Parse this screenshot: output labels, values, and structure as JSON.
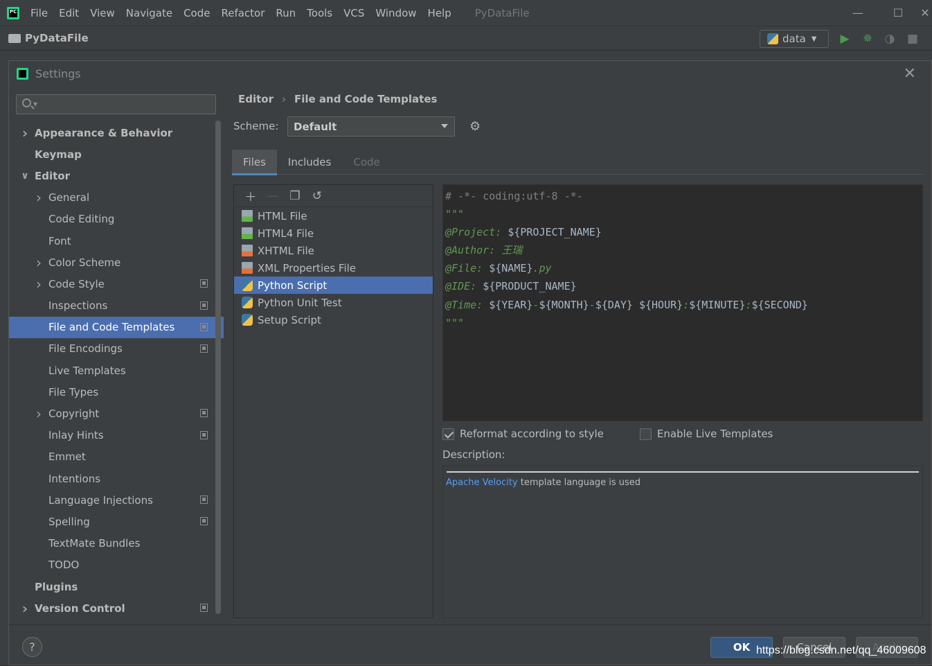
{
  "ide": {
    "menu": [
      "File",
      "Edit",
      "View",
      "Navigate",
      "Code",
      "Refactor",
      "Run",
      "Tools",
      "VCS",
      "Window",
      "Help"
    ],
    "window_title": "PyDataFile",
    "logo_text": "PC",
    "project_name": "PyDataFile",
    "run_config": "data"
  },
  "dialog": {
    "title": "Settings",
    "search_placeholder": "",
    "tree": [
      {
        "label": "Appearance & Behavior",
        "bold": true,
        "level": 0,
        "chevron": "right",
        "copy": false
      },
      {
        "label": "Keymap",
        "bold": true,
        "level": 0,
        "chevron": "",
        "copy": false
      },
      {
        "label": "Editor",
        "bold": true,
        "level": 0,
        "chevron": "down",
        "copy": false
      },
      {
        "label": "General",
        "bold": false,
        "level": 1,
        "chevron": "right",
        "copy": false
      },
      {
        "label": "Code Editing",
        "bold": false,
        "level": 1,
        "chevron": "",
        "copy": false
      },
      {
        "label": "Font",
        "bold": false,
        "level": 1,
        "chevron": "",
        "copy": false
      },
      {
        "label": "Color Scheme",
        "bold": false,
        "level": 1,
        "chevron": "right",
        "copy": false
      },
      {
        "label": "Code Style",
        "bold": false,
        "level": 1,
        "chevron": "right",
        "copy": true
      },
      {
        "label": "Inspections",
        "bold": false,
        "level": 1,
        "chevron": "",
        "copy": true
      },
      {
        "label": "File and Code Templates",
        "bold": false,
        "level": 1,
        "chevron": "",
        "copy": true,
        "selected": true
      },
      {
        "label": "File Encodings",
        "bold": false,
        "level": 1,
        "chevron": "",
        "copy": true
      },
      {
        "label": "Live Templates",
        "bold": false,
        "level": 1,
        "chevron": "",
        "copy": false
      },
      {
        "label": "File Types",
        "bold": false,
        "level": 1,
        "chevron": "",
        "copy": false
      },
      {
        "label": "Copyright",
        "bold": false,
        "level": 1,
        "chevron": "right",
        "copy": true
      },
      {
        "label": "Inlay Hints",
        "bold": false,
        "level": 1,
        "chevron": "",
        "copy": true
      },
      {
        "label": "Emmet",
        "bold": false,
        "level": 1,
        "chevron": "",
        "copy": false
      },
      {
        "label": "Intentions",
        "bold": false,
        "level": 1,
        "chevron": "",
        "copy": false
      },
      {
        "label": "Language Injections",
        "bold": false,
        "level": 1,
        "chevron": "",
        "copy": true
      },
      {
        "label": "Spelling",
        "bold": false,
        "level": 1,
        "chevron": "",
        "copy": true
      },
      {
        "label": "TextMate Bundles",
        "bold": false,
        "level": 1,
        "chevron": "",
        "copy": false
      },
      {
        "label": "TODO",
        "bold": false,
        "level": 1,
        "chevron": "",
        "copy": false
      },
      {
        "label": "Plugins",
        "bold": true,
        "level": 0,
        "chevron": "",
        "copy": false
      },
      {
        "label": "Version Control",
        "bold": true,
        "level": 0,
        "chevron": "right",
        "copy": true
      }
    ],
    "breadcrumb": {
      "first": "Editor",
      "separator": "›",
      "second": "File and Code Templates"
    },
    "scheme": {
      "label": "Scheme:",
      "value": "Default"
    },
    "tabs": [
      {
        "label": "Files",
        "state": "active"
      },
      {
        "label": "Includes",
        "state": "normal"
      },
      {
        "label": "Code",
        "state": "disabled"
      }
    ],
    "templates": [
      {
        "label": "HTML File",
        "icon": "html-file-icon",
        "kind": "green"
      },
      {
        "label": "HTML4 File",
        "icon": "html-file-icon",
        "kind": "green"
      },
      {
        "label": "XHTML File",
        "icon": "xhtml-file-icon",
        "kind": "orange"
      },
      {
        "label": "XML Properties File",
        "icon": "xml-file-icon",
        "kind": "orange"
      },
      {
        "label": "Python Script",
        "icon": "python-file-icon",
        "kind": "python",
        "selected": true
      },
      {
        "label": "Python Unit Test",
        "icon": "python-file-icon",
        "kind": "python"
      },
      {
        "label": "Setup Script",
        "icon": "python-file-icon",
        "kind": "python"
      }
    ],
    "editor_lines": [
      [
        {
          "t": "# -*- coding:utf-8 -*-",
          "c": "c-comment"
        }
      ],
      [
        {
          "t": "\"\"\"",
          "c": "c-docplain"
        }
      ],
      [
        {
          "t": "@Project: ",
          "c": "c-doc"
        },
        {
          "t": "${PROJECT_NAME}",
          "c": "c-var"
        }
      ],
      [
        {
          "t": "@Author: 王瑞",
          "c": "c-doc"
        }
      ],
      [
        {
          "t": "@File: ",
          "c": "c-doc"
        },
        {
          "t": "${NAME}",
          "c": "c-var"
        },
        {
          "t": ".py",
          "c": "c-doc"
        }
      ],
      [
        {
          "t": "@IDE: ",
          "c": "c-doc"
        },
        {
          "t": "${PRODUCT_NAME}",
          "c": "c-var"
        }
      ],
      [
        {
          "t": "@Time: ",
          "c": "c-doc"
        },
        {
          "t": "${YEAR}",
          "c": "c-var"
        },
        {
          "t": "-",
          "c": "c-doc"
        },
        {
          "t": "${MONTH}",
          "c": "c-var"
        },
        {
          "t": "-",
          "c": "c-doc"
        },
        {
          "t": "${DAY}",
          "c": "c-var"
        },
        {
          "t": " ",
          "c": "c-doc"
        },
        {
          "t": "${HOUR}",
          "c": "c-var"
        },
        {
          "t": ":",
          "c": "c-doc"
        },
        {
          "t": "${MINUTE}",
          "c": "c-var"
        },
        {
          "t": ":",
          "c": "c-doc"
        },
        {
          "t": "${SECOND}",
          "c": "c-var"
        }
      ],
      [
        {
          "t": "\"\"\"",
          "c": "c-docplain"
        }
      ]
    ],
    "options": {
      "reformat": {
        "label": "Reformat according to style",
        "checked": true
      },
      "live_templates": {
        "label": "Enable Live Templates",
        "checked": false
      }
    },
    "description": {
      "label": "Description:",
      "link": "Apache Velocity",
      "text": " template language is used"
    },
    "buttons": {
      "help": "?",
      "ok": "OK",
      "cancel": "Cancel",
      "apply": "Apply"
    },
    "watermark": "https://blog.csdn.net/qq_46009608"
  }
}
